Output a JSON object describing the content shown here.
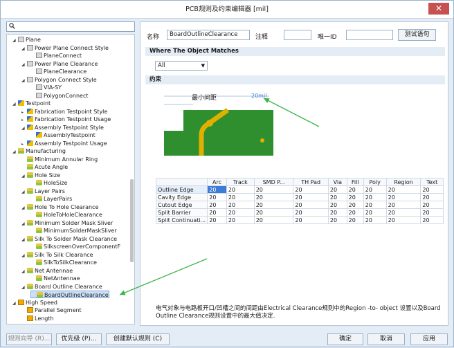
{
  "window": {
    "title": "PCB规则及约束编辑器 [mil]",
    "close": "✕"
  },
  "search": {
    "icon": "search-icon",
    "value": ""
  },
  "tree": [
    {
      "label": "Plane",
      "level": 1,
      "expander": "◢",
      "icon": "grid"
    },
    {
      "label": "Power Plane Connect Style",
      "level": 2,
      "expander": "◢",
      "icon": "grid"
    },
    {
      "label": "PlaneConnect",
      "level": 3,
      "expander": "",
      "icon": "grid"
    },
    {
      "label": "Power Plane Clearance",
      "level": 2,
      "expander": "◢",
      "icon": "grid"
    },
    {
      "label": "PlaneClearance",
      "level": 3,
      "expander": "",
      "icon": "grid"
    },
    {
      "label": "Polygon Connect Style",
      "level": 2,
      "expander": "◢",
      "icon": "grid"
    },
    {
      "label": "VIA-SY",
      "level": 3,
      "expander": "",
      "icon": "grid"
    },
    {
      "label": "PolygonConnect",
      "level": 3,
      "expander": "",
      "icon": "grid"
    },
    {
      "label": "Testpoint",
      "level": 1,
      "expander": "◢",
      "icon": "tp"
    },
    {
      "label": "Fabrication Testpoint Style",
      "level": 2,
      "expander": "▸",
      "icon": "tp"
    },
    {
      "label": "Fabrication Testpoint Usage",
      "level": 2,
      "expander": "▸",
      "icon": "tp"
    },
    {
      "label": "Assembly Testpoint Style",
      "level": 2,
      "expander": "◢",
      "icon": "tp"
    },
    {
      "label": "AssemblyTestpoint",
      "level": 3,
      "expander": "",
      "icon": "tp"
    },
    {
      "label": "Assembly Testpoint Usage",
      "level": 2,
      "expander": "▸",
      "icon": "tp"
    },
    {
      "label": "Manufacturing",
      "level": 1,
      "expander": "◢",
      "icon": "mf"
    },
    {
      "label": "Minimum Annular Ring",
      "level": 2,
      "expander": "",
      "icon": "mf"
    },
    {
      "label": "Acute Angle",
      "level": 2,
      "expander": "",
      "icon": "mf"
    },
    {
      "label": "Hole Size",
      "level": 2,
      "expander": "◢",
      "icon": "mf"
    },
    {
      "label": "HoleSize",
      "level": 3,
      "expander": "",
      "icon": "mf"
    },
    {
      "label": "Layer Pairs",
      "level": 2,
      "expander": "◢",
      "icon": "mf"
    },
    {
      "label": "LayerPairs",
      "level": 3,
      "expander": "",
      "icon": "mf"
    },
    {
      "label": "Hole To Hole Clearance",
      "level": 2,
      "expander": "◢",
      "icon": "mf"
    },
    {
      "label": "HoleToHoleClearance",
      "level": 3,
      "expander": "",
      "icon": "mf"
    },
    {
      "label": "Minimum Solder Mask Sliver",
      "level": 2,
      "expander": "◢",
      "icon": "mf"
    },
    {
      "label": "MinimumSolderMaskSliver",
      "level": 3,
      "expander": "",
      "icon": "mf"
    },
    {
      "label": "Silk To Solder Mask Clearance",
      "level": 2,
      "expander": "◢",
      "icon": "mf"
    },
    {
      "label": "SilkscreenOverComponentF",
      "level": 3,
      "expander": "",
      "icon": "mf"
    },
    {
      "label": "Silk To Silk Clearance",
      "level": 2,
      "expander": "◢",
      "icon": "mf"
    },
    {
      "label": "SilkToSilkClearance",
      "level": 3,
      "expander": "",
      "icon": "mf"
    },
    {
      "label": "Net Antennae",
      "level": 2,
      "expander": "◢",
      "icon": "mf"
    },
    {
      "label": "NetAntennae",
      "level": 3,
      "expander": "",
      "icon": "mf"
    },
    {
      "label": "Board Outline Clearance",
      "level": 2,
      "expander": "◢",
      "icon": "mf"
    },
    {
      "label": "BoardOutlineClearance",
      "level": 3,
      "expander": "",
      "icon": "mf",
      "selected": true
    },
    {
      "label": "High Speed",
      "level": 1,
      "expander": "◢",
      "icon": "hs"
    },
    {
      "label": "Parallel Segment",
      "level": 2,
      "expander": "",
      "icon": "hs"
    },
    {
      "label": "Length",
      "level": 2,
      "expander": "",
      "icon": "hs"
    }
  ],
  "form": {
    "name_label": "名称",
    "name_value": "BoardOutlineClearance",
    "comment_label": "注释",
    "comment_value": "",
    "uid_label": "唯一ID",
    "uid_value": "",
    "test_button": "测试语句",
    "where_title": "Where The Object Matches",
    "scope_select": "All",
    "constraints_title": "约束",
    "min_gap_label": "最小间距",
    "min_gap_value": "20mil"
  },
  "table": {
    "columns": [
      "Arc",
      "Track",
      "SMD P...",
      "TH Pad",
      "Via",
      "Fill",
      "Poly",
      "Region",
      "Text"
    ],
    "rows": [
      {
        "name": "Outline Edge",
        "values": [
          "20",
          "20",
          "20",
          "20",
          "20",
          "20",
          "20",
          "20",
          "20"
        ]
      },
      {
        "name": "Cavity Edge",
        "values": [
          "20",
          "20",
          "20",
          "20",
          "20",
          "20",
          "20",
          "20",
          "20"
        ]
      },
      {
        "name": "Cutout Edge",
        "values": [
          "20",
          "20",
          "20",
          "20",
          "20",
          "20",
          "20",
          "20",
          "20"
        ]
      },
      {
        "name": "Split Barrier",
        "values": [
          "20",
          "20",
          "20",
          "20",
          "20",
          "20",
          "20",
          "20",
          "20"
        ]
      },
      {
        "name": "Split Continuati...",
        "values": [
          "20",
          "20",
          "20",
          "20",
          "20",
          "20",
          "20",
          "20",
          "20"
        ]
      }
    ]
  },
  "description": "电气对象与电路板开口/凹槽之间的间距由Electrical Clearance规则中的Region -to- object 设置以及Board Outline Clearance规则设置中的最大值决定.",
  "footer": {
    "rule_wizard": "规则向导 (R)...",
    "priority": "优先级 (P)...",
    "create_default": "创建默认规则 (C)",
    "ok": "确定",
    "cancel": "取消",
    "apply": "应用"
  },
  "colors": {
    "board": "#2f8f2f",
    "trace": "#e0b000",
    "arrow": "#3ab54a",
    "selection": "#3d7bd8"
  }
}
